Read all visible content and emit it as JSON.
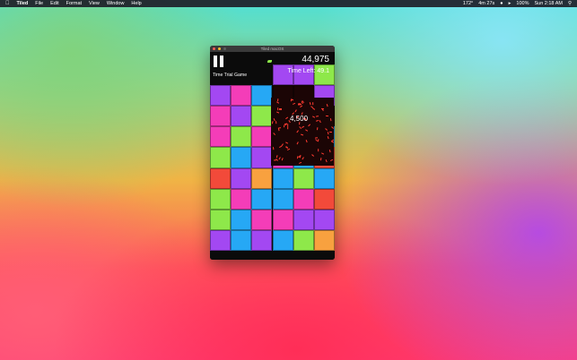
{
  "menubar": {
    "apple_icon": "apple-icon",
    "app_name": "Tiled",
    "menus": [
      "File",
      "Edit",
      "Format",
      "View",
      "Window",
      "Help"
    ],
    "status": {
      "temp": "172°",
      "timer": "4m 27s",
      "battery": "100%",
      "clock": "Sun 2:18 AM"
    }
  },
  "window": {
    "title": "Tiled macOS",
    "traffic_lights": [
      "#fe5f57",
      "#febc2e",
      "#5e5e5e"
    ]
  },
  "hud": {
    "score": "44,975",
    "time_left_label": "Time Left:",
    "time_left_value": "49.1",
    "mode": "Time Trial Game",
    "points_popup": "4,500"
  },
  "palette": {
    "purple": "#a348f2",
    "pink": "#f43db8",
    "green": "#8ee84a",
    "blue": "#26a8f5",
    "red": "#f24a3a",
    "orange": "#f8a13f",
    "dark": "#1b0505"
  },
  "tiles": [
    [
      "",
      "",
      "",
      "purple",
      "purple",
      "green"
    ],
    [
      "purple",
      "pink",
      "blue",
      "dark",
      "dark",
      "purple"
    ],
    [
      "pink",
      "purple",
      "green",
      "dark",
      "dark",
      "dark"
    ],
    [
      "pink",
      "green",
      "pink",
      "green",
      "dark",
      "blue"
    ],
    [
      "green",
      "blue",
      "purple",
      "pink",
      "blue",
      "red"
    ],
    [
      "red",
      "purple",
      "orange",
      "blue",
      "green",
      "blue"
    ],
    [
      "green",
      "pink",
      "blue",
      "blue",
      "pink",
      "red"
    ],
    [
      "green",
      "blue",
      "pink",
      "pink",
      "purple",
      "purple"
    ],
    [
      "purple",
      "blue",
      "purple",
      "blue",
      "green",
      "orange"
    ]
  ]
}
